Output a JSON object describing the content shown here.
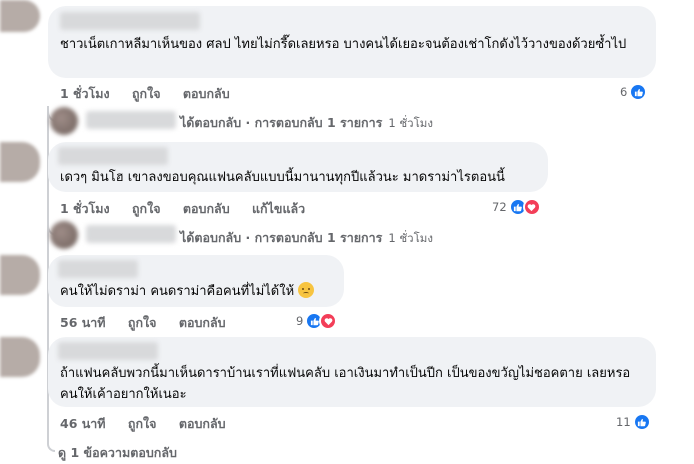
{
  "comments": [
    {
      "text": "ชาวเน็ตเกาหลีมาเห็นของ ศลป ไทยไม่กรี๊ดเลยหรอ บางคนได้เยอะจนต้องเช่าโกดังไว้วางของด้วยซ้ำไป",
      "time": "1 ชั่วโมง",
      "like_label": "ถูกใจ",
      "reply_label": "ตอบกลับ",
      "reaction_count": "6",
      "reaction_icons": [
        "like-icon"
      ]
    },
    {
      "text": "เดวๆ มินโฮ เขาลงขอบคุณแฟนคลับแบบนี้มานานทุกปีแล้วนะ มาดราม่าไรตอนนี้",
      "time": "1 ชั่วโมง",
      "like_label": "ถูกใจ",
      "reply_label": "ตอบกลับ",
      "edited_label": "แก้ไขแล้ว",
      "reaction_count": "72",
      "reaction_icons": [
        "like-icon",
        "love-icon"
      ]
    },
    {
      "text": "คนให้ไม่ดราม่า คนดราม่าคือคนที่ไม่ได้ให้",
      "emoji": "sad-face-emoji",
      "time": "56 นาที",
      "like_label": "ถูกใจ",
      "reply_label": "ตอบกลับ",
      "reaction_count": "9",
      "reaction_icons": [
        "like-icon",
        "love-icon"
      ]
    },
    {
      "text": "ถ้าแฟนคลับพวกนี้มาเห็นดาราบ้านเราที่แฟนคลับ เอาเงินมาทำเป็นปีก เป็นของขวัญไม่ชอคตาย เลยหรอ คนให้เค้าอยากให้เนอะ",
      "time": "46 นาที",
      "like_label": "ถูกใจ",
      "reply_label": "ตอบกลับ",
      "reaction_count": "11",
      "reaction_icons": [
        "like-icon"
      ]
    }
  ],
  "reply_summaries": [
    {
      "text": "ได้ตอบกลับ · การตอบกลับ 1 รายการ",
      "time": "1 ชั่วโมง"
    },
    {
      "text": "ได้ตอบกลับ · การตอบกลับ 1 รายการ",
      "time": "1 ชั่วโมง"
    }
  ],
  "view_more_replies": "ดู 1 ข้อความตอบกลับ",
  "colors": {
    "bubble": "#f0f2f5",
    "meta_text": "#65676b",
    "like_blue": "#1877f2",
    "love_red": "#f33e58",
    "thread_line": "#ced0d4"
  }
}
